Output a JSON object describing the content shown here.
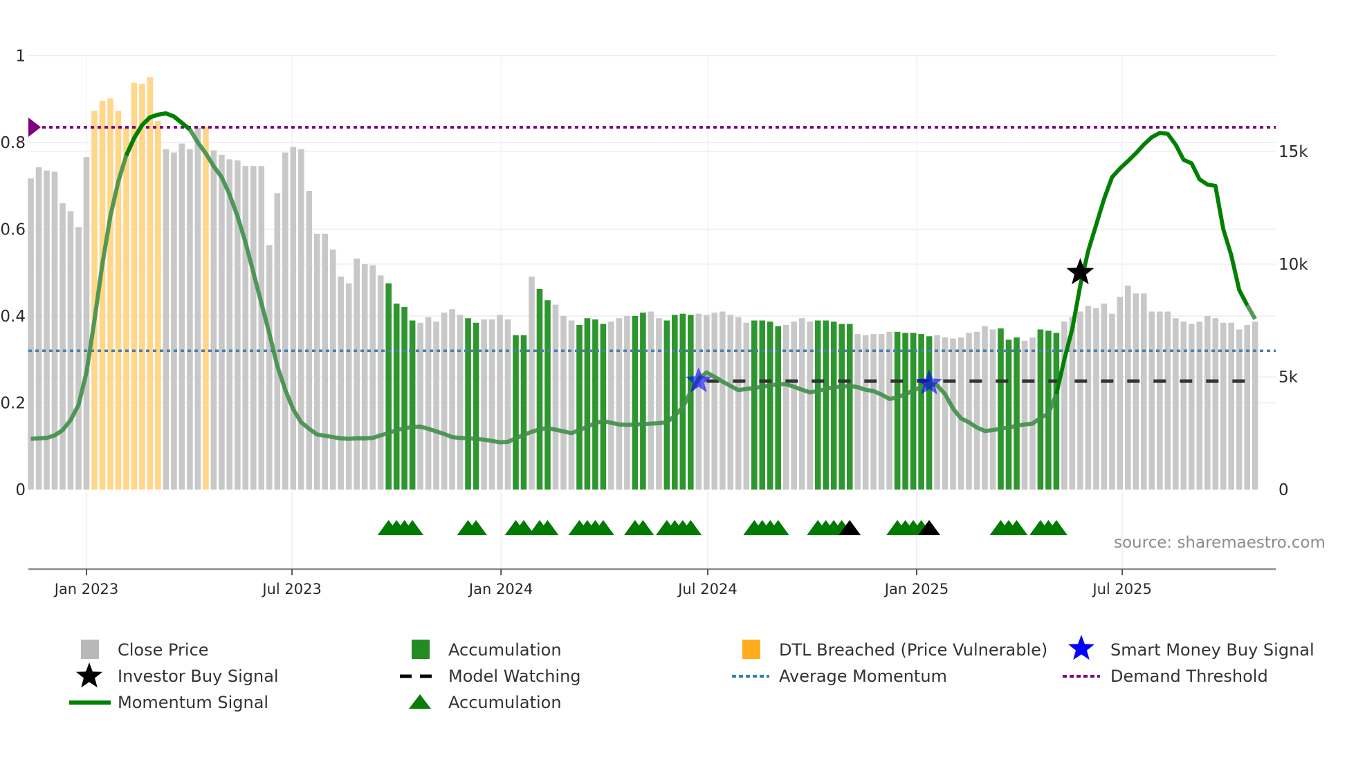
{
  "chart_data": {
    "type": "bar",
    "title": "",
    "xlabel": "",
    "ylabel_left": "",
    "ylabel_right": "",
    "grid": true,
    "legend_placement": "bottom",
    "source_note": "source: sharemaestro.com",
    "x_ticks": [
      {
        "date": "2023-01-01",
        "label": "Jan 2023"
      },
      {
        "date": "2023-07-01",
        "label": "Jul 2023"
      },
      {
        "date": "2024-01-01",
        "label": "Jan 2024"
      },
      {
        "date": "2024-07-01",
        "label": "Jul 2024"
      },
      {
        "date": "2025-01-01",
        "label": "Jan 2025"
      },
      {
        "date": "2025-07-01",
        "label": "Jul 2025"
      }
    ],
    "y_left": {
      "range": [
        0,
        1
      ],
      "ticks": [
        0,
        0.2,
        0.4,
        0.6,
        0.8,
        1
      ],
      "tick_labels": [
        "0",
        "0.2",
        "0.4",
        "0.6",
        "0.8",
        "1"
      ]
    },
    "y_right": {
      "range": [
        0,
        19250
      ],
      "ticks": [
        0,
        5000,
        10000,
        15000
      ],
      "tick_labels": [
        "0",
        "5k",
        "10k",
        "15k"
      ]
    },
    "x": [
      "2022-11-13",
      "2022-11-20",
      "2022-11-27",
      "2022-12-04",
      "2022-12-11",
      "2022-12-18",
      "2022-12-25",
      "2023-01-01",
      "2023-01-08",
      "2023-01-15",
      "2023-01-22",
      "2023-01-29",
      "2023-02-05",
      "2023-02-12",
      "2023-02-19",
      "2023-02-26",
      "2023-03-05",
      "2023-03-12",
      "2023-03-19",
      "2023-03-26",
      "2023-04-02",
      "2023-04-09",
      "2023-04-16",
      "2023-04-23",
      "2023-04-30",
      "2023-05-07",
      "2023-05-14",
      "2023-05-21",
      "2023-05-28",
      "2023-06-04",
      "2023-06-11",
      "2023-06-18",
      "2023-06-25",
      "2023-07-02",
      "2023-07-09",
      "2023-07-16",
      "2023-07-23",
      "2023-07-30",
      "2023-08-06",
      "2023-08-13",
      "2023-08-20",
      "2023-08-27",
      "2023-09-03",
      "2023-09-10",
      "2023-09-17",
      "2023-09-24",
      "2023-10-01",
      "2023-10-08",
      "2023-10-15",
      "2023-10-22",
      "2023-10-29",
      "2023-11-05",
      "2023-11-12",
      "2023-11-19",
      "2023-11-26",
      "2023-12-03",
      "2023-12-10",
      "2023-12-17",
      "2023-12-24",
      "2023-12-31",
      "2024-01-07",
      "2024-01-14",
      "2024-01-21",
      "2024-01-28",
      "2024-02-04",
      "2024-02-11",
      "2024-02-18",
      "2024-02-25",
      "2024-03-03",
      "2024-03-10",
      "2024-03-17",
      "2024-03-24",
      "2024-03-31",
      "2024-04-07",
      "2024-04-14",
      "2024-04-21",
      "2024-04-28",
      "2024-05-05",
      "2024-05-12",
      "2024-05-19",
      "2024-05-26",
      "2024-06-02",
      "2024-06-09",
      "2024-06-16",
      "2024-06-23",
      "2024-06-30",
      "2024-07-07",
      "2024-07-14",
      "2024-07-21",
      "2024-07-28",
      "2024-08-04",
      "2024-08-11",
      "2024-08-18",
      "2024-08-25",
      "2024-09-01",
      "2024-09-08",
      "2024-09-15",
      "2024-09-22",
      "2024-09-29",
      "2024-10-06",
      "2024-10-13",
      "2024-10-20",
      "2024-10-27",
      "2024-11-03",
      "2024-11-10",
      "2024-11-17",
      "2024-11-24",
      "2024-12-01",
      "2024-12-08",
      "2024-12-15",
      "2024-12-22",
      "2024-12-29",
      "2025-01-05",
      "2025-01-12",
      "2025-01-19",
      "2025-01-26",
      "2025-02-02",
      "2025-02-09",
      "2025-02-16",
      "2025-02-23",
      "2025-03-02",
      "2025-03-09",
      "2025-03-16",
      "2025-03-23",
      "2025-03-30",
      "2025-04-06",
      "2025-04-13",
      "2025-04-20",
      "2025-04-27",
      "2025-05-04",
      "2025-05-11",
      "2025-05-18",
      "2025-05-25",
      "2025-06-01",
      "2025-06-08",
      "2025-06-15",
      "2025-06-22",
      "2025-06-29",
      "2025-07-06",
      "2025-07-13",
      "2025-07-20",
      "2025-07-27",
      "2025-08-03",
      "2025-08-10",
      "2025-08-17",
      "2025-08-24",
      "2025-08-31",
      "2025-09-07",
      "2025-09-14",
      "2025-09-21",
      "2025-09-28",
      "2025-10-05",
      "2025-10-12",
      "2025-10-19",
      "2025-10-26"
    ],
    "series": [
      {
        "name": "Close Price",
        "axis": "right",
        "type": "bar",
        "values": [
          13800,
          14300,
          14150,
          14100,
          12700,
          12350,
          11650,
          14750,
          16800,
          17250,
          17350,
          16800,
          16050,
          18050,
          18000,
          18300,
          16350,
          15100,
          14950,
          15350,
          15100,
          16050,
          16100,
          15050,
          14850,
          14650,
          14600,
          14350,
          14350,
          14350,
          10850,
          13150,
          14950,
          15200,
          15100,
          13250,
          11350,
          11350,
          10650,
          9450,
          9150,
          10250,
          10000,
          9950,
          9500,
          9150,
          8250,
          8100,
          7500,
          7400,
          7650,
          7450,
          7850,
          8000,
          7750,
          7600,
          7400,
          7550,
          7550,
          7750,
          7550,
          6850,
          6850,
          9450,
          8900,
          8400,
          8200,
          7700,
          7500,
          7300,
          7600,
          7550,
          7350,
          7450,
          7600,
          7700,
          7700,
          7850,
          7900,
          7600,
          7500,
          7750,
          7800,
          7750,
          7800,
          7750,
          7850,
          7900,
          7750,
          7650,
          7400,
          7500,
          7500,
          7450,
          7250,
          7300,
          7450,
          7600,
          7450,
          7500,
          7500,
          7450,
          7350,
          7350,
          6900,
          6850,
          6900,
          6900,
          7000,
          7000,
          6950,
          6950,
          6900,
          6800,
          6850,
          6750,
          6700,
          6750,
          6950,
          7000,
          7250,
          7100,
          7150,
          6650,
          6750,
          6600,
          6750,
          7100,
          7050,
          6950,
          7450,
          7650,
          7900,
          8150,
          8050,
          8250,
          7800,
          8550,
          9050,
          8700,
          8700,
          7900,
          7900,
          7900,
          7600,
          7450,
          7350,
          7450,
          7700,
          7600,
          7400,
          7400,
          7100,
          7300,
          7450,
          7150,
          7350
        ]
      },
      {
        "name": "Momentum Signal",
        "axis": "left",
        "type": "line",
        "values": [
          0.117,
          0.118,
          0.119,
          0.125,
          0.137,
          0.16,
          0.195,
          0.27,
          0.39,
          0.52,
          0.63,
          0.71,
          0.77,
          0.81,
          0.84,
          0.858,
          0.864,
          0.867,
          0.86,
          0.845,
          0.83,
          0.8,
          0.775,
          0.745,
          0.72,
          0.68,
          0.63,
          0.57,
          0.5,
          0.43,
          0.36,
          0.285,
          0.23,
          0.185,
          0.155,
          0.14,
          0.127,
          0.124,
          0.121,
          0.118,
          0.117,
          0.118,
          0.118,
          0.119,
          0.125,
          0.13,
          0.137,
          0.141,
          0.144,
          0.145,
          0.14,
          0.134,
          0.128,
          0.121,
          0.119,
          0.118,
          0.117,
          0.115,
          0.112,
          0.109,
          0.11,
          0.118,
          0.126,
          0.133,
          0.139,
          0.142,
          0.138,
          0.134,
          0.13,
          0.137,
          0.145,
          0.153,
          0.158,
          0.154,
          0.15,
          0.149,
          0.15,
          0.151,
          0.152,
          0.153,
          0.155,
          0.17,
          0.19,
          0.225,
          0.255,
          0.27,
          0.26,
          0.249,
          0.239,
          0.229,
          0.232,
          0.234,
          0.237,
          0.24,
          0.243,
          0.243,
          0.237,
          0.23,
          0.224,
          0.227,
          0.232,
          0.236,
          0.237,
          0.239,
          0.236,
          0.23,
          0.227,
          0.219,
          0.209,
          0.212,
          0.22,
          0.228,
          0.236,
          0.245,
          0.24,
          0.22,
          0.187,
          0.164,
          0.155,
          0.143,
          0.135,
          0.137,
          0.14,
          0.143,
          0.147,
          0.15,
          0.152,
          0.165,
          0.175,
          0.22,
          0.3,
          0.37,
          0.47,
          0.55,
          0.61,
          0.67,
          0.72,
          0.74,
          0.757,
          0.775,
          0.795,
          0.812,
          0.822,
          0.82,
          0.795,
          0.76,
          0.752,
          0.715,
          0.703,
          0.7,
          0.6,
          0.54,
          0.46,
          0.425,
          0.393,
          0.362,
          0.34
        ]
      }
    ],
    "bar_status_runs": [
      [
        "C",
        8
      ],
      [
        "D",
        9
      ],
      [
        "C",
        5
      ],
      [
        "D",
        1
      ],
      [
        "C",
        22
      ],
      [
        "A",
        4
      ],
      [
        "C",
        6
      ],
      [
        "A",
        2
      ],
      [
        "C",
        4
      ],
      [
        "A",
        2
      ],
      [
        "C",
        1
      ],
      [
        "A",
        2
      ],
      [
        "C",
        3
      ],
      [
        "A",
        4
      ],
      [
        "C",
        3
      ],
      [
        "A",
        2
      ],
      [
        "C",
        2
      ],
      [
        "A",
        4
      ],
      [
        "C",
        7
      ],
      [
        "A",
        4
      ],
      [
        "C",
        4
      ],
      [
        "A",
        5
      ],
      [
        "C",
        5
      ],
      [
        "A",
        5
      ],
      [
        "C",
        8
      ],
      [
        "A",
        3
      ],
      [
        "C",
        2
      ],
      [
        "A",
        3
      ],
      [
        "C",
        27
      ]
    ],
    "bar_status_names": {
      "C": "Close Price",
      "A": "Accumulation",
      "D": "DTL Breached (Price Vulnerable)"
    },
    "accumulation_triangles_black_dates": [
      "2024-11-03",
      "2025-01-12"
    ],
    "smart_money_buy_signals": [
      {
        "date": "2024-06-23",
        "value": 0.25
      },
      {
        "date": "2025-01-12",
        "value": 0.245
      }
    ],
    "investor_buy_signals": [
      {
        "date": "2025-05-25",
        "value": 0.5
      }
    ],
    "model_watching": {
      "start": "2024-06-30",
      "end": "2025-10-19",
      "value": 0.25
    },
    "average_momentum": 0.32,
    "demand_threshold": 0.835,
    "colors": {
      "close_price": "#c8c8c8",
      "accumulation_bar": "#2e962e",
      "dtl_breached": "#ffd68a",
      "dtl_legend": "#ffad1f",
      "momentum": "#008000",
      "momentum_faded": "#3f8f48",
      "average_momentum": "#4a7fa8",
      "demand_threshold": "#800080",
      "smart_money": "#0000ff",
      "investor_buy": "#000000",
      "model_watching": "#000000",
      "triangle": "#007a00",
      "legend_close": "#b8b8b8",
      "legend_accum": "#228b22"
    }
  },
  "legend": {
    "close_price": "Close Price",
    "accumulation_bar": "Accumulation",
    "dtl_breached": "DTL Breached (Price Vulnerable)",
    "smart_money": "Smart Money Buy Signal",
    "investor_buy": "Investor Buy Signal",
    "model_watching": "Model Watching",
    "average_momentum": "Average Momentum",
    "demand_threshold": "Demand Threshold",
    "momentum": "Momentum Signal",
    "accumulation_triangle": "Accumulation"
  }
}
